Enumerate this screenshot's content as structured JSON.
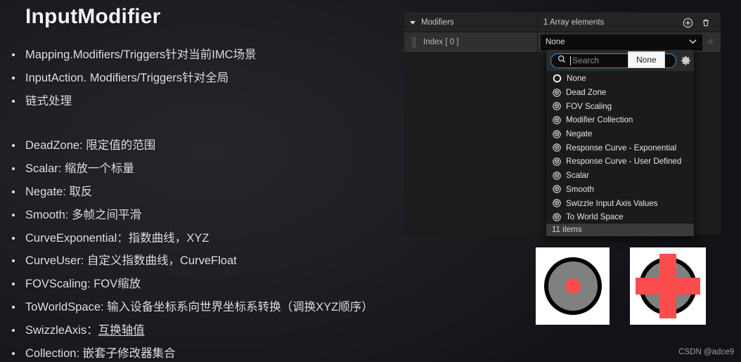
{
  "slide": {
    "title": "InputModifier",
    "bullets": [
      {
        "text": "Mapping.Modifiers/Triggers针对当前IMC场景"
      },
      {
        "text": "InputAction. Modifiers/Triggers针对全局"
      },
      {
        "text": "链式处理"
      },
      {
        "text": "",
        "spacer": true
      },
      {
        "text": "DeadZone: 限定值的范围"
      },
      {
        "text": "Scalar: 缩放一个标量"
      },
      {
        "text": "Negate: 取反"
      },
      {
        "text": "Smooth: 多帧之间平滑"
      },
      {
        "text": "CurveExponential：指数曲线，XYZ"
      },
      {
        "text": "CurveUser: 自定义指数曲线，CurveFloat"
      },
      {
        "text": "FOVScaling: FOV缩放"
      },
      {
        "text": "ToWorldSpace: 输入设备坐标系向世界坐标系转换（调换XYZ顺序）"
      },
      {
        "text": "SwizzleAxis：",
        "underlined": "互换轴值"
      },
      {
        "text": "Collection: 嵌套子修改器集合"
      }
    ]
  },
  "panel": {
    "category_label": "Modifiers",
    "array_count_label": "1 Array elements",
    "add_icon": "plus-circle-icon",
    "delete_icon": "trash-icon",
    "row": {
      "index_label": "Index [ 0 ]",
      "combo_value": "None"
    }
  },
  "dropdown": {
    "search_placeholder": "Search",
    "settings_icon": "gear-icon",
    "items": [
      {
        "label": "None",
        "icon": "circle-outline-icon"
      },
      {
        "label": "Dead Zone",
        "icon": "class-cube-icon"
      },
      {
        "label": "FOV Scaling",
        "icon": "class-cube-icon"
      },
      {
        "label": "Modifier Collection",
        "icon": "class-cube-icon"
      },
      {
        "label": "Negate",
        "icon": "class-cube-icon"
      },
      {
        "label": "Response Curve - Exponential",
        "icon": "class-cube-icon"
      },
      {
        "label": "Response Curve - User Defined",
        "icon": "class-cube-icon"
      },
      {
        "label": "Scalar",
        "icon": "class-cube-icon"
      },
      {
        "label": "Smooth",
        "icon": "class-cube-icon"
      },
      {
        "label": "Swizzle Input Axis Values",
        "icon": "class-cube-icon"
      },
      {
        "label": "To World Space",
        "icon": "class-cube-icon"
      }
    ],
    "footer_label": "11 items",
    "tooltip_label": "None"
  },
  "thumbnails": [
    {
      "name": "analog-stick-icon",
      "type": "dot"
    },
    {
      "name": "dpad-cross-icon",
      "type": "cross"
    }
  ],
  "watermark": "CSDN @adce9",
  "colors": {
    "accent_red": "#fb4d4d",
    "accent_blue": "#2f94e0",
    "panel_bg": "#1c1c1c",
    "row_bg": "#303030"
  }
}
